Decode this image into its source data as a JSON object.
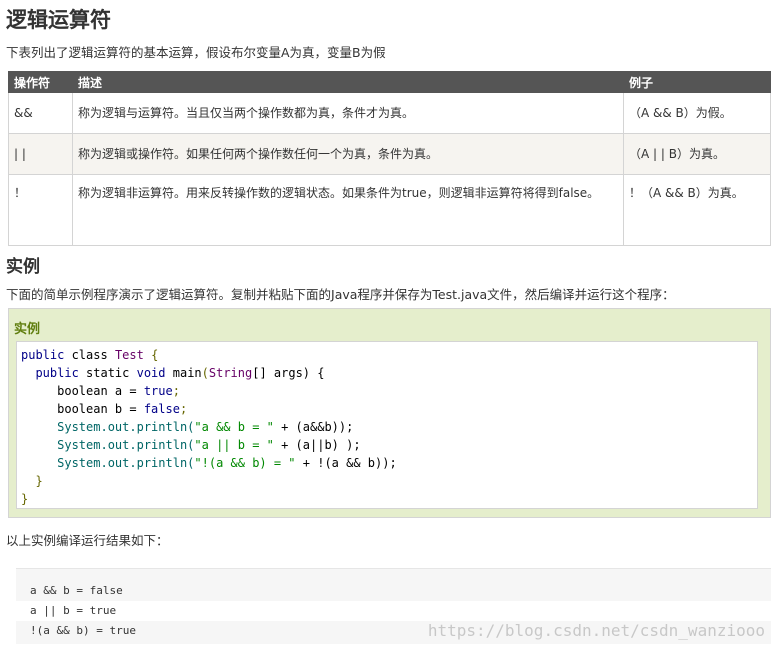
{
  "page": {
    "title": "逻辑运算符",
    "intro": "下表列出了逻辑运算符的基本运算，假设布尔变量A为真，变量B为假",
    "table": {
      "headers": [
        "操作符",
        "描述",
        "例子"
      ],
      "rows": [
        {
          "op": "&&",
          "desc": "称为逻辑与运算符。当且仅当两个操作数都为真，条件才为真。",
          "example": "（A && B）为假。"
        },
        {
          "op": "| |",
          "desc": "称为逻辑或操作符。如果任何两个操作数任何一个为真，条件为真。",
          "example": "（A | | B）为真。"
        },
        {
          "op": "！",
          "desc": "称为逻辑非运算符。用来反转操作数的逻辑状态。如果条件为true，则逻辑非运算符将得到false。",
          "example": "！（A && B）为真。"
        }
      ]
    },
    "section_title": "实例",
    "section_desc": "下面的简单示例程序演示了逻辑运算符。复制并粘贴下面的Java程序并保存为Test.java文件，然后编译并运行这个程序：",
    "example_label": "实例",
    "code": {
      "l1": [
        "public",
        " class ",
        "Test",
        " {"
      ],
      "l2": [
        "  ",
        "public",
        " static ",
        "void",
        " main",
        "(",
        "String",
        "[] args) {"
      ],
      "l3": [
        "     boolean a = ",
        "true",
        ";"
      ],
      "l4": [
        "     boolean b = ",
        "false",
        ";"
      ],
      "l5": [
        "     System.out.println(",
        "\"a && b = \"",
        " + (a&&b));"
      ],
      "l6": [
        "     System.out.println(",
        "\"a || b = \"",
        " + (a||b) );"
      ],
      "l7": [
        "     System.out.println(",
        "\"!(a && b) = \"",
        " + !(a && b));"
      ],
      "l8": [
        "  }"
      ],
      "l9": [
        "}"
      ]
    },
    "result_desc": "以上实例编译运行结果如下：",
    "output": [
      "a && b = false",
      "a || b = true",
      "!(a && b) = true"
    ],
    "watermark": "https://blog.csdn.net/csdn_wanziooo"
  }
}
